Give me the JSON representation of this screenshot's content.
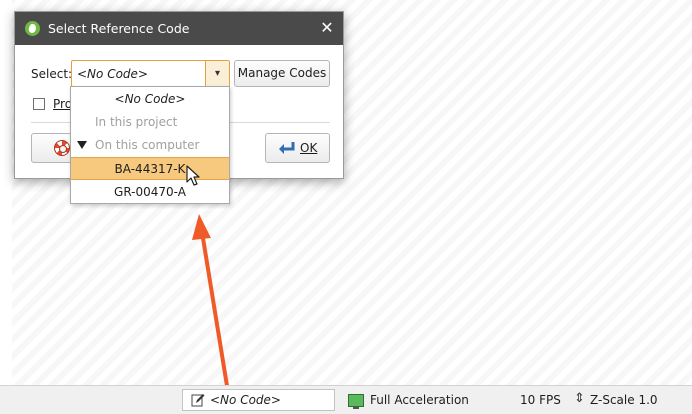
{
  "dialog": {
    "title": "Select Reference Code",
    "close_glyph": "✕",
    "select_label": "Select:",
    "combo_value": "<No Code>",
    "combo_arrow_glyph": "▾",
    "manage_codes_label": "Manage Codes",
    "checkbox_label_partial": "Pro",
    "ok_label": "OK"
  },
  "dropdown": {
    "items": [
      {
        "label": "<No Code>",
        "kind": "option"
      },
      {
        "label": "In this project",
        "kind": "group"
      },
      {
        "label": "On this computer",
        "kind": "group"
      },
      {
        "label": "BA-44317-K",
        "kind": "option",
        "selected": true
      },
      {
        "label": "GR-00470-A",
        "kind": "option"
      }
    ]
  },
  "statusbar": {
    "code": "<No Code>",
    "acceleration": "Full Acceleration",
    "fps": "10 FPS",
    "zscale": "Z-Scale 1.0"
  },
  "colors": {
    "titlebar": "#4a4a4a",
    "highlight": "#f7c97f",
    "annotation_arrow": "#f05a28",
    "app_icon": "#6fb843"
  },
  "icons": {
    "app": "leapfrog-app-icon",
    "help": "lifebuoy-icon",
    "ok": "ok-enter-icon",
    "status_edit": "edit-icon",
    "status_monitor": "monitor-icon",
    "zscale": "z-scale-icon"
  }
}
